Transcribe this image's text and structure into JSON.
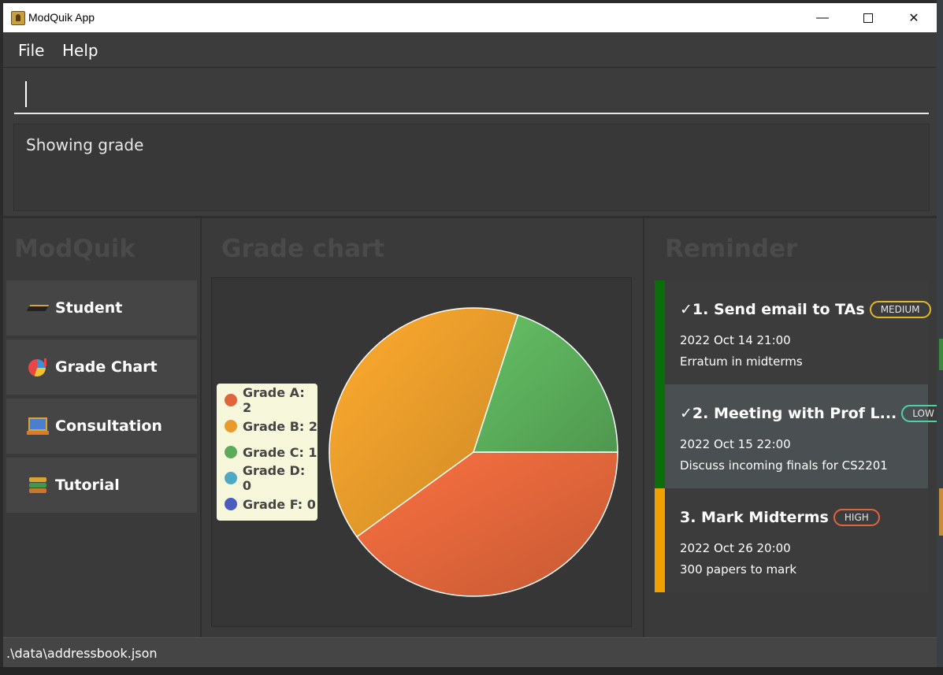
{
  "window": {
    "title": "ModQuik App",
    "minimize_symbol": "—",
    "close_symbol": "✕"
  },
  "menu": {
    "file": "File",
    "help": "Help"
  },
  "command": {
    "value": ""
  },
  "result": {
    "text": "Showing grade"
  },
  "nav": {
    "title": "ModQuik",
    "items": [
      {
        "label": "Student",
        "icon": "graduation-cap-icon"
      },
      {
        "label": "Grade Chart",
        "icon": "pie-chart-icon"
      },
      {
        "label": "Consultation",
        "icon": "classroom-icon"
      },
      {
        "label": "Tutorial",
        "icon": "books-icon"
      }
    ]
  },
  "grade_panel": {
    "title": "Grade chart",
    "legend": [
      {
        "label": "Grade A: 2",
        "color": "#e0653a"
      },
      {
        "label": "Grade B: 2",
        "color": "#e89a2a"
      },
      {
        "label": "Grade C: 1",
        "color": "#5aac5a"
      },
      {
        "label": "Grade D: 0",
        "color": "#4fa8c4"
      },
      {
        "label": "Grade F: 0",
        "color": "#4a5cc0"
      }
    ]
  },
  "chart_data": {
    "type": "pie",
    "categories": [
      "Grade A",
      "Grade B",
      "Grade C",
      "Grade D",
      "Grade F"
    ],
    "values": [
      2,
      2,
      1,
      0,
      0
    ],
    "colors": [
      "#e0653a",
      "#e89a2a",
      "#5aac5a",
      "#4fa8c4",
      "#4a5cc0"
    ],
    "title": "",
    "legend_position": "left"
  },
  "reminders": {
    "title": "Reminder",
    "items": [
      {
        "head": "✓1.  Send email to TAs",
        "priority": "MEDIUM",
        "priority_color": "#e0b82a",
        "stripe_color": "#0a6e0a",
        "bg": "#3c3c3c",
        "date": "2022 Oct 14 21:00",
        "desc": "Erratum in midterms"
      },
      {
        "head": "✓2.  Meeting with Prof L...",
        "priority": "LOW",
        "priority_color": "#4fd1a8",
        "stripe_color": "#0a6e0a",
        "bg": "#4a4f52",
        "date": "2022 Oct 15 22:00",
        "desc": "Discuss incoming finals for CS2201"
      },
      {
        "head": "3.  Mark Midterms",
        "priority": "HIGH",
        "priority_color": "#e0653a",
        "stripe_color": "#f0a000",
        "bg": "#3c3c3c",
        "date": "2022 Oct 26 20:00",
        "desc": "300 papers to mark"
      }
    ]
  },
  "status": {
    "path": ".\\data\\addressbook.json"
  }
}
